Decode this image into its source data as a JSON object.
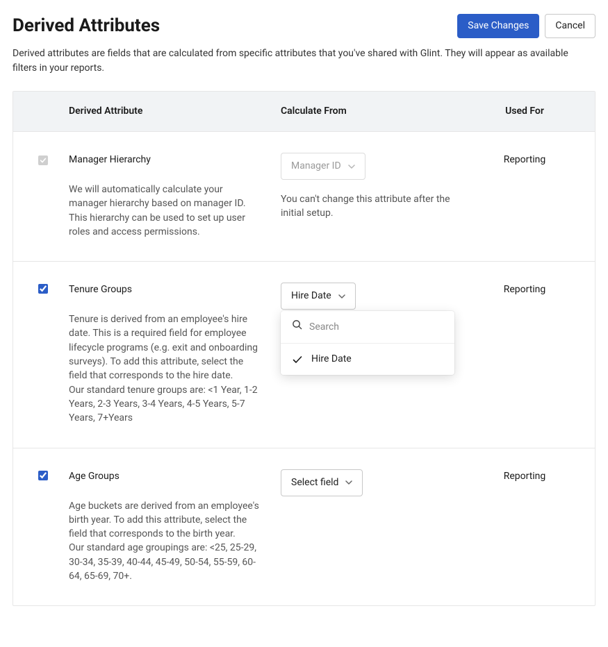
{
  "header": {
    "title": "Derived Attributes",
    "save_label": "Save Changes",
    "cancel_label": "Cancel",
    "description": "Derived attributes are fields that are calculated from specific attributes that you've shared with Glint. They will appear as available filters in your reports."
  },
  "columns": {
    "derived_attribute": "Derived Attribute",
    "calculate_from": "Calculate From",
    "used_for": "Used For"
  },
  "rows": [
    {
      "checked": true,
      "disabled": true,
      "name": "Manager Hierarchy",
      "description": "We will automatically calculate your manager hierarchy based on manager ID. This hierarchy can be used to set up user roles and access permissions.",
      "select_label": "Manager ID",
      "select_disabled": true,
      "calc_note": "You can't change this attribute after the initial setup.",
      "used_for": "Reporting"
    },
    {
      "checked": true,
      "disabled": false,
      "name": "Tenure Groups",
      "description": "Tenure is derived from an employee's hire date. This is a required field for employee lifecycle programs (e.g. exit and onboarding surveys). To add this attribute, select the field that corresponds to the hire date.\nOur standard tenure groups are: <1 Year, 1-2 Years, 2-3 Years, 3-4 Years, 4-5 Years, 5-7 Years, 7+Years",
      "select_label": "Hire Date",
      "select_disabled": false,
      "used_for": "Reporting",
      "dropdown": {
        "search_placeholder": "Search",
        "options": [
          {
            "label": "Hire Date",
            "selected": true
          }
        ]
      }
    },
    {
      "checked": true,
      "disabled": false,
      "name": "Age Groups",
      "description": "Age buckets are derived from an employee's birth year. To add this attribute, select the field that corresponds to the birth year.\nOur standard age groupings are: <25, 25-29, 30-34, 35-39, 40-44, 45-49, 50-54, 55-59, 60-64, 65-69, 70+.",
      "select_label": "Select field",
      "select_disabled": false,
      "used_for": "Reporting"
    }
  ]
}
